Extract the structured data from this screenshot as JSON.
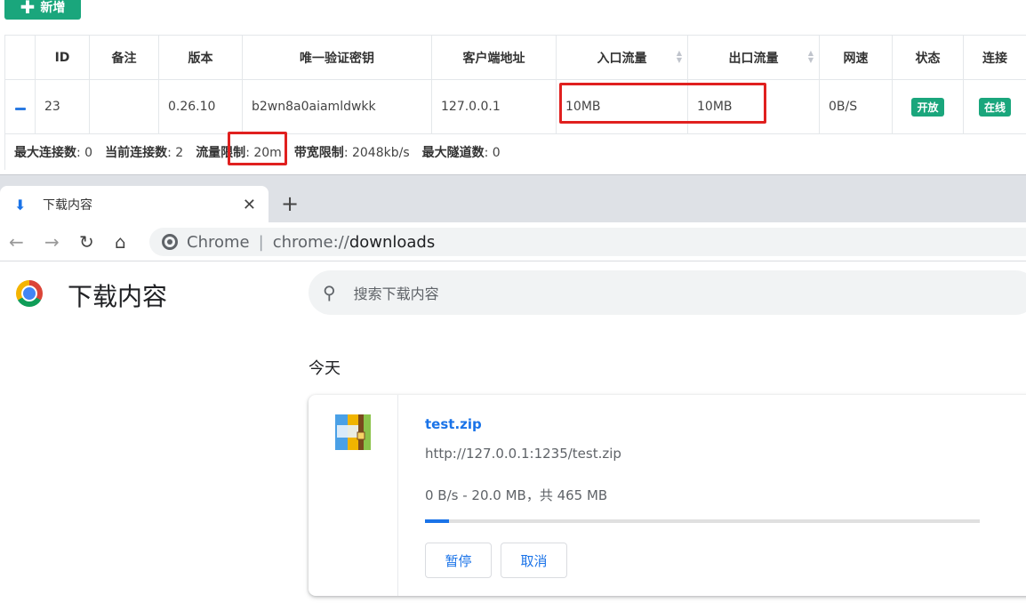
{
  "admin": {
    "add_button": "新增",
    "columns": [
      {
        "label": ""
      },
      {
        "label": "ID"
      },
      {
        "label": "备注"
      },
      {
        "label": "版本"
      },
      {
        "label": "唯一验证密钥"
      },
      {
        "label": "客户端地址"
      },
      {
        "label": "入口流量"
      },
      {
        "label": "出口流量"
      },
      {
        "label": "网速"
      },
      {
        "label": "状态"
      },
      {
        "label": "连接"
      }
    ],
    "row": {
      "id": "23",
      "remark": "",
      "version": "0.26.10",
      "key": "b2wn8a0aiamldwkk",
      "address": "127.0.0.1",
      "inlet_flow": "10MB",
      "export_flow": "10MB",
      "speed": "0B/S",
      "status": "开放",
      "connection": "在线"
    },
    "details": [
      {
        "label": "最大连接数",
        "value": "0"
      },
      {
        "label": "当前连接数",
        "value": "2"
      },
      {
        "label": "流量限制",
        "value": "20m"
      },
      {
        "label": "带宽限制",
        "value": "2048kb/s"
      },
      {
        "label": "最大隧道数",
        "value": "0"
      }
    ]
  },
  "browser": {
    "tab_title": "下载内容",
    "tab_close": "✕",
    "new_tab": "+",
    "omnibox": {
      "site": "Chrome",
      "separator": "|",
      "scheme": "chrome://",
      "path": "downloads"
    }
  },
  "downloads": {
    "page_title": "下载内容",
    "search_placeholder": "搜索下载内容",
    "section_date": "今天",
    "item": {
      "file_name": "test.zip",
      "url": "http://127.0.0.1:1235/test.zip",
      "progress_text": "0 B/s - 20.0 MB，共 465 MB",
      "progress_fraction": 0.043,
      "pause_label": "暂停",
      "cancel_label": "取消"
    }
  },
  "colors": {
    "brand_green": "#1aa67c",
    "link_blue": "#1a73e8",
    "annotation_red": "#e0201f"
  }
}
